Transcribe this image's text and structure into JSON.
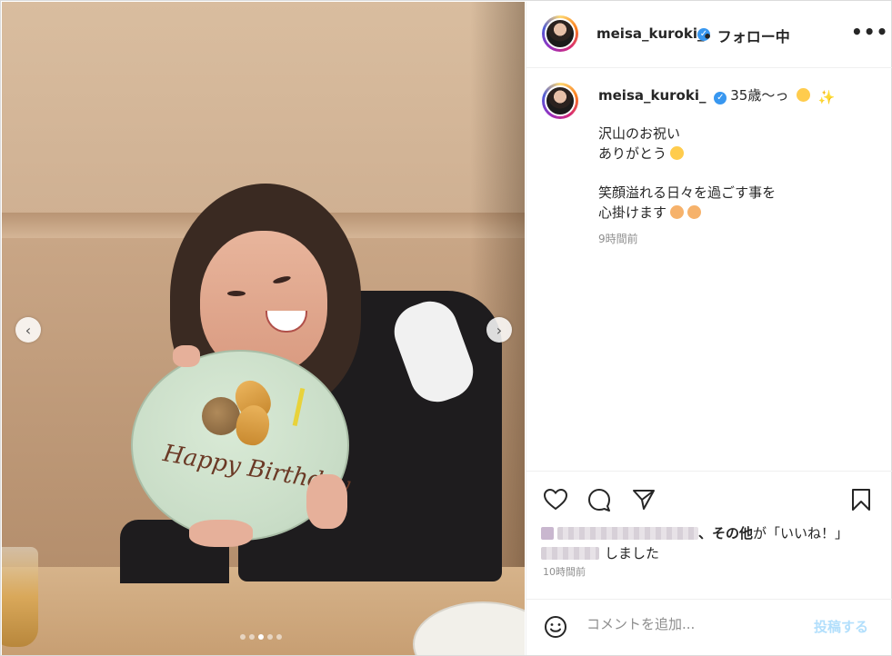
{
  "post": {
    "author": "meisa_kuroki_",
    "follow_status": "• フォロー中",
    "more_glyph": "•••",
    "caption_title": "35歳〜っ",
    "caption_lines": [
      "沢山のお祝い",
      "ありがとう",
      "笑顔溢れる日々を過ごす事を",
      "心掛けます"
    ],
    "caption_time": "9時間前",
    "plate_text": "Happy Birthday"
  },
  "media": {
    "prev_glyph": "‹",
    "next_glyph": "›",
    "dots_count": 5,
    "active_dot": 2
  },
  "likes": {
    "more_text": "、その他",
    "suffix_1": "が「いいね！」",
    "suffix_2": "しました",
    "posted_time": "10時間前"
  },
  "comment": {
    "placeholder": "コメントを追加...",
    "post_label": "投稿する"
  },
  "icons": {
    "like": "heart-outline-icon",
    "comment": "comment-bubble-icon",
    "share": "paper-plane-icon",
    "save": "bookmark-icon",
    "emoji": "smiley-icon",
    "verified": "verified-badge-icon"
  },
  "colors": {
    "verified": "#3897f0",
    "post_button_disabled": "#b2dffc",
    "secondary_text": "#8e8e8e"
  }
}
